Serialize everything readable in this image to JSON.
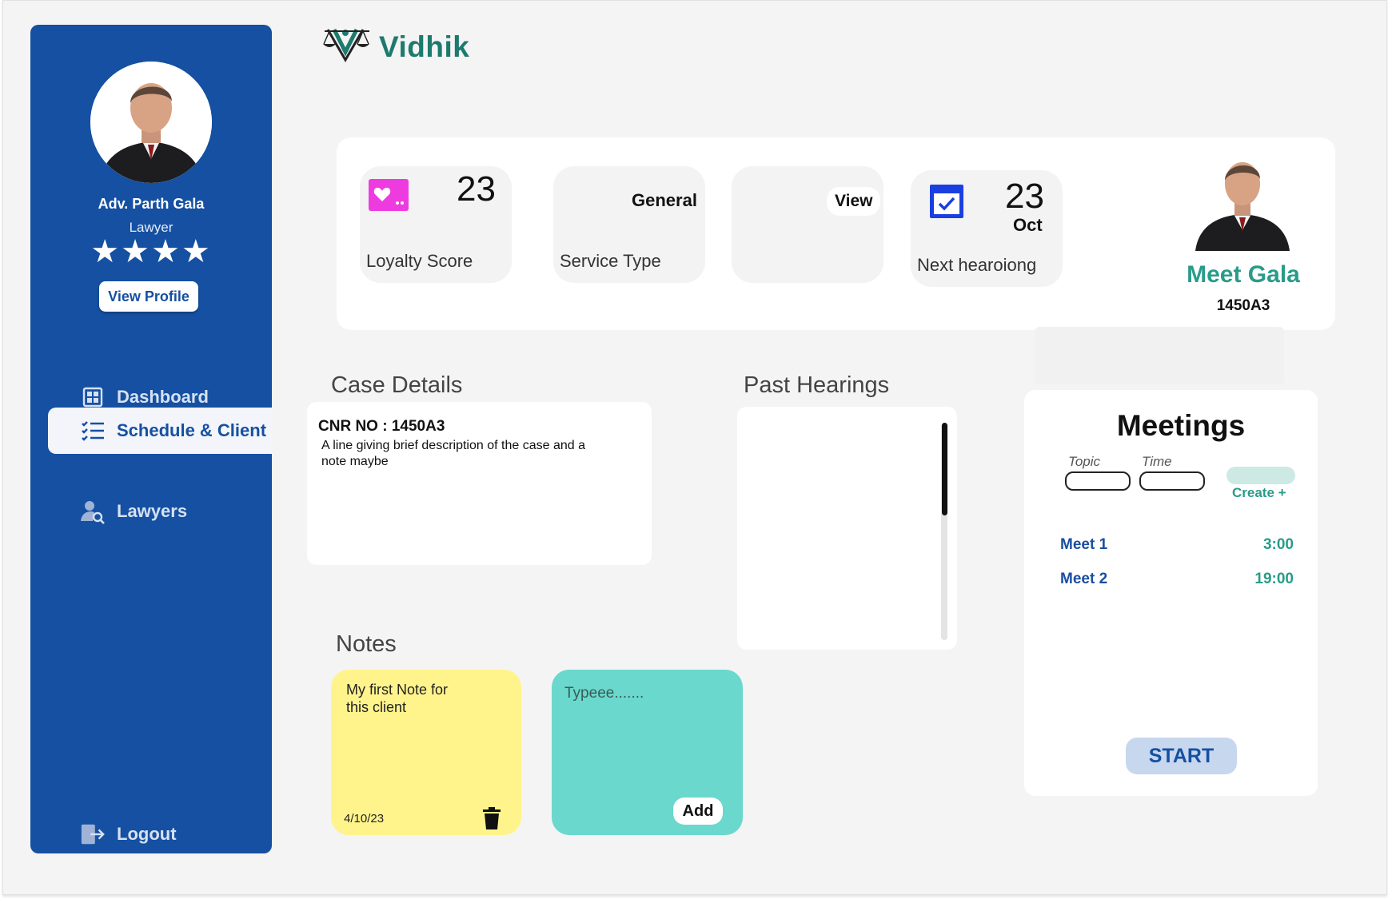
{
  "app": {
    "logo_text": "Vidhik"
  },
  "sidebar": {
    "profile": {
      "name": "Adv. Parth Gala",
      "role": "Lawyer",
      "rating": "★★★★",
      "view_profile_label": "View Profile"
    },
    "nav": [
      {
        "label": "Dashboard",
        "icon": "grid-icon"
      },
      {
        "label": "Schedule & Client",
        "icon": "checklist-icon",
        "active": true
      },
      {
        "label": "Lawyers",
        "icon": "user-search-icon"
      }
    ],
    "logout_label": "Logout"
  },
  "stats": {
    "loyalty": {
      "value": "23",
      "label": "Loyalty Score",
      "icon": "heart-card-icon"
    },
    "service": {
      "value": "General",
      "label": "Service Type"
    },
    "view": {
      "label": "View"
    },
    "hearing": {
      "day": "23",
      "month": "Oct",
      "label": "Next hearoiong",
      "icon": "calendar-check-icon"
    }
  },
  "client": {
    "name": "Meet Gala",
    "id": "1450A3"
  },
  "case_details": {
    "title": "Case Details",
    "cnr": "CNR NO  : 1450A3",
    "description": "A line giving brief description of the case and a note maybe"
  },
  "past_hearings": {
    "title": "Past Hearings"
  },
  "notes": {
    "title": "Notes",
    "items": [
      {
        "text": "My first Note for this client",
        "date": "4/10/23"
      }
    ],
    "new_note_placeholder": "Typeee.......",
    "add_label": "Add"
  },
  "meetings": {
    "title": "Meetings",
    "topic_label": "Topic",
    "time_label": "Time",
    "create_label": "Create +",
    "list": [
      {
        "name": "Meet 1",
        "time": "3:00"
      },
      {
        "name": "Meet 2",
        "time": "19:00"
      }
    ],
    "start_label": "START"
  },
  "colors": {
    "sidebar": "#1550a2",
    "accent_teal": "#2a9b8a",
    "note_yellow": "#fff48b",
    "note_teal": "#6ad8cd",
    "loyalty_icon": "#ee3be0",
    "calendar_icon": "#1a3fe0"
  }
}
